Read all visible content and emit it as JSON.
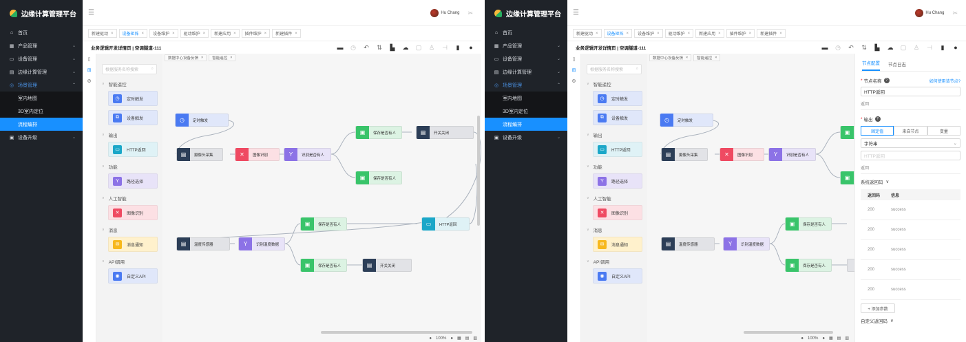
{
  "app": {
    "title": "边缘计算管理平台"
  },
  "user": {
    "name": "Hu Chang"
  },
  "sidebar": {
    "items": [
      {
        "label": "首页",
        "icon": "home-icon"
      },
      {
        "label": "产品管理",
        "icon": "grid-icon"
      },
      {
        "label": "设备管理",
        "icon": "monitor-icon"
      },
      {
        "label": "边缘计算管理",
        "icon": "doc-icon"
      },
      {
        "label": "场景管理",
        "icon": "scene-icon"
      }
    ],
    "sub_items": [
      "室内地图",
      "3D室内定位",
      "流程编排"
    ],
    "last_item": {
      "label": "设备升级",
      "icon": "upgrade-icon"
    }
  },
  "tabs": [
    {
      "label": "新建驱动"
    },
    {
      "label": "设备矩阵"
    },
    {
      "label": "设备维护"
    },
    {
      "label": "驱动维护"
    },
    {
      "label": "新建应用"
    },
    {
      "label": "插件维护"
    },
    {
      "label": "新建插件"
    }
  ],
  "page": {
    "title": "业务逻辑开发详情页 | 空调隧道-111"
  },
  "palette": {
    "search_placeholder": "根据服务名称搜索",
    "categories": [
      {
        "name": "智能遥控",
        "items": [
          "定时触发",
          "设备触发"
        ]
      },
      {
        "name": "输出",
        "items": [
          "HTTP返回"
        ]
      },
      {
        "name": "功能",
        "items": [
          "路径选择"
        ]
      },
      {
        "name": "人工智能",
        "items": [
          "图像识别"
        ]
      },
      {
        "name": "消息",
        "items": [
          "消息通知"
        ]
      },
      {
        "name": "API调用",
        "items": [
          "自定义API"
        ]
      }
    ]
  },
  "canvas_tabs": [
    "数据中心设备反馈",
    "智能遥控"
  ],
  "flow": {
    "nodes": {
      "timer": "定时触发",
      "camera": "摄像头采集",
      "image": "图像识别",
      "recognize": "识别是否有人",
      "save1": "保存是否有人",
      "switch1": "开关关闭",
      "save2": "保存是否有人",
      "save3": "保存是否有人",
      "http": "HTTP返回",
      "temp": "温度传感器",
      "tempdata": "识别温度数据",
      "save4": "保存是否有人",
      "switch2": "开关关闭"
    }
  },
  "zoom": "100%",
  "panel": {
    "tabs": [
      "节点配置",
      "节点日志"
    ],
    "node_name_label": "节点名称",
    "help_link": "如何使用该节点?",
    "node_name_value": "HTTP返回",
    "return_label": "返回",
    "output_label": "输出",
    "output_modes": [
      "固定值",
      "来自节点",
      "变量"
    ],
    "type_value": "字符串",
    "http_placeholder": "HTTP返回",
    "return_label2": "返回",
    "sys_codes_label": "系统返回码",
    "table_headers": [
      "返回码",
      "信息"
    ],
    "codes": [
      {
        "code": "200",
        "info": "success"
      },
      {
        "code": "200",
        "info": "success"
      },
      {
        "code": "200",
        "info": "success"
      },
      {
        "code": "200",
        "info": "success"
      },
      {
        "code": "200",
        "info": "success"
      }
    ],
    "add_param": "+ 添加参数",
    "custom_codes_label": "自定义返回码"
  }
}
